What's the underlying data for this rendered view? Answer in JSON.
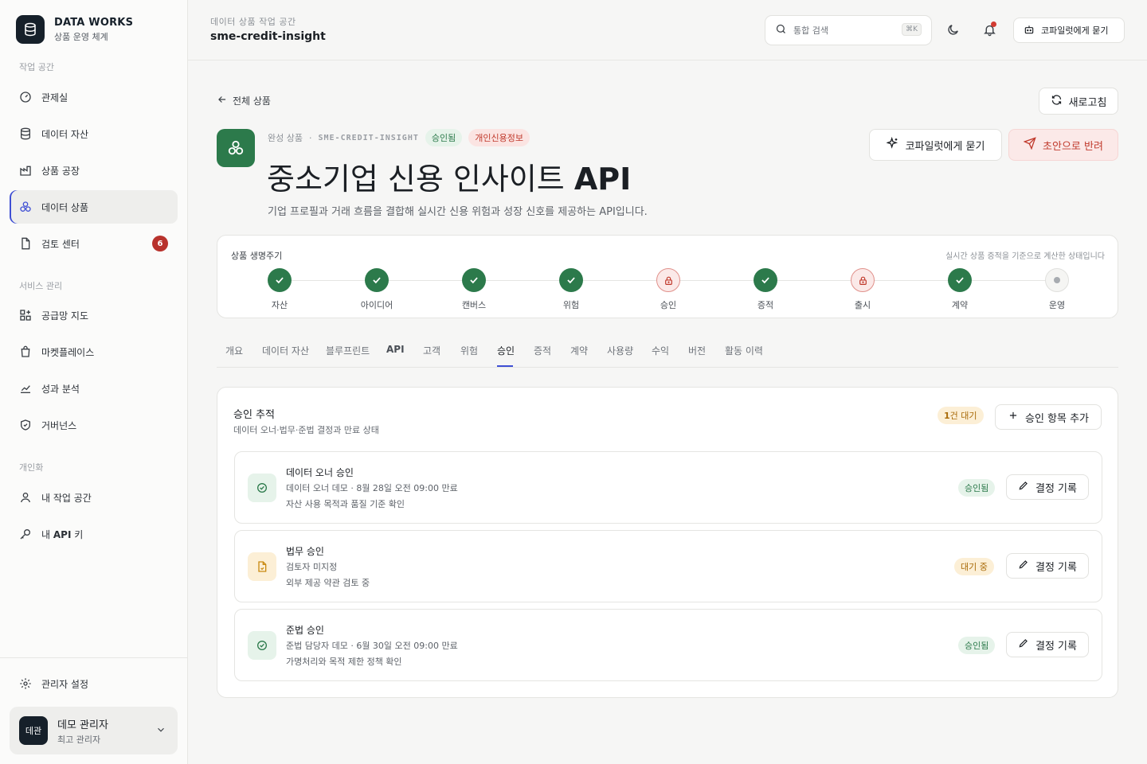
{
  "brand": {
    "title": "DATA WORKS",
    "subtitle": "상품 운영 체계"
  },
  "sidebar": {
    "sections": [
      "작업 공간",
      "서비스 관리",
      "개인화"
    ],
    "items": [
      {
        "label": "관제실",
        "icon": "gauge-icon"
      },
      {
        "label": "데이터 자산",
        "icon": "database-icon"
      },
      {
        "label": "상품 공장",
        "icon": "factory-icon"
      },
      {
        "label": "데이터 상품",
        "icon": "cubes-icon",
        "active": true
      },
      {
        "label": "검토 센터",
        "icon": "document-icon",
        "badge": "6"
      },
      {
        "label": "공급망 지도",
        "icon": "grid-plus-icon"
      },
      {
        "label": "마켓플레이스",
        "icon": "bag-icon"
      },
      {
        "label": "성과 분석",
        "icon": "chart-icon"
      },
      {
        "label": "거버넌스",
        "icon": "shield-icon"
      },
      {
        "label": "내 작업 공간",
        "icon": "user-icon"
      },
      {
        "label_prefix": "내 ",
        "label_bold": "API",
        "label_suffix": " 키",
        "icon": "key-icon"
      }
    ],
    "settings_label": "관리자 설정",
    "user": {
      "avatar": "데관",
      "name": "데모 관리자",
      "role": "최고 관리자"
    }
  },
  "topbar": {
    "workspace_label": "데이터 상품 작업 공간",
    "workspace_name": "sme-credit-insight",
    "search_placeholder": "통합 검색",
    "search_shortcut": "⌘K",
    "copilot_label": "코파일럿에게 묻기"
  },
  "main": {
    "back_label": "전체 상품",
    "refresh_label": "새로고침",
    "copilot_label": "코파일럿에게 묻기",
    "return_label": "초안으로 반려",
    "product": {
      "kind": "완성 상품",
      "slug": "SME-CREDIT-INSIGHT",
      "status": "승인됨",
      "sensitivity": "개인신용정보",
      "title_main": "중소기업 신용 인사이트 ",
      "title_bold": "API",
      "description": "기업 프로필과 거래 흐름을 결합해 실시간 신용 위험과 성장 신호를 제공하는 API입니다."
    },
    "lifecycle": {
      "label": "상품 생명주기",
      "note": "실시간 상품 증적을 기준으로 계산한 상태입니다",
      "steps": [
        {
          "name": "자산",
          "state": "done"
        },
        {
          "name": "아이디어",
          "state": "done"
        },
        {
          "name": "캔버스",
          "state": "done"
        },
        {
          "name": "위험",
          "state": "done"
        },
        {
          "name": "승인",
          "state": "locked"
        },
        {
          "name": "증적",
          "state": "done"
        },
        {
          "name": "출시",
          "state": "locked"
        },
        {
          "name": "계약",
          "state": "done"
        },
        {
          "name": "운영",
          "state": "pending"
        }
      ]
    },
    "tabs": [
      "개요",
      "데이터 자산",
      "블루프린트",
      "API",
      "고객",
      "위험",
      "승인",
      "증적",
      "계약",
      "사용량",
      "수익",
      "버전",
      "활동 이력"
    ],
    "active_tab": "승인",
    "approvals": {
      "title": "승인 추적",
      "subtitle": "데이터 오너·법무·준법 결정과 만료 상태",
      "waiting_bold": "1",
      "waiting_rest": "건 대기",
      "add_label": "승인 항목 추가",
      "record_label": "결정 기록",
      "items": [
        {
          "title": "데이터 오너 승인",
          "meta": "데이터 오너 데모 · 8월 28일 오전 09:00 만료",
          "note": "자산 사용 목적과 품질 기준 확인",
          "status": "승인됨",
          "state": "approved"
        },
        {
          "title": "법무 승인",
          "meta": "검토자 미지정",
          "note": "외부 제공 약관 검토 중",
          "status": "대기 중",
          "state": "waiting"
        },
        {
          "title": "준법 승인",
          "meta": "준법 담당자 데모 · 6월 30일 오전 09:00 만료",
          "note": "가명처리와 목적 제한 정책 확인",
          "status": "승인됨",
          "state": "approved"
        }
      ]
    }
  },
  "colors": {
    "accent": "#3f4fd4",
    "success": "#2c7a4b",
    "danger": "#c0392b",
    "warning": "#a96b09",
    "ink": "#16202a"
  }
}
